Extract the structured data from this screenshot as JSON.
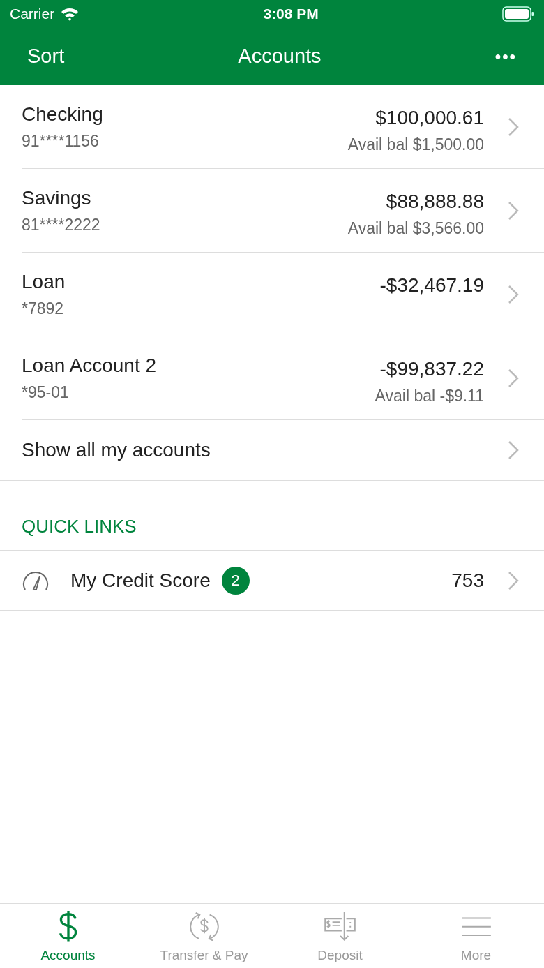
{
  "status_bar": {
    "carrier": "Carrier",
    "time": "3:08 PM"
  },
  "nav_bar": {
    "left": "Sort",
    "title": "Accounts",
    "menu": "•••"
  },
  "accounts": [
    {
      "name": "Checking",
      "number": "91****1156",
      "balance": "$100,000.61",
      "available": "Avail bal $1,500.00"
    },
    {
      "name": "Savings",
      "number": "81****2222",
      "balance": "$88,888.88",
      "available": "Avail bal $3,566.00"
    },
    {
      "name": "Loan",
      "number": "*7892",
      "balance": "-$32,467.19"
    },
    {
      "name": "Loan Account 2",
      "number": "*95-01",
      "balance": "-$99,837.22",
      "available": "Avail bal -$9.11"
    }
  ],
  "show_all": "Show all my accounts",
  "quick_links": {
    "heading": "QUICK LINKS",
    "items": [
      {
        "label": "My Credit Score",
        "badge": "2",
        "value": "753"
      }
    ]
  },
  "tab_bar": [
    {
      "label": "Accounts",
      "kind": "dollar",
      "selected": true
    },
    {
      "label": "Transfer & Pay",
      "kind": "transfer",
      "selected": false
    },
    {
      "label": "Deposit",
      "kind": "deposit",
      "selected": false
    },
    {
      "label": "More",
      "kind": "menu",
      "selected": false
    }
  ]
}
